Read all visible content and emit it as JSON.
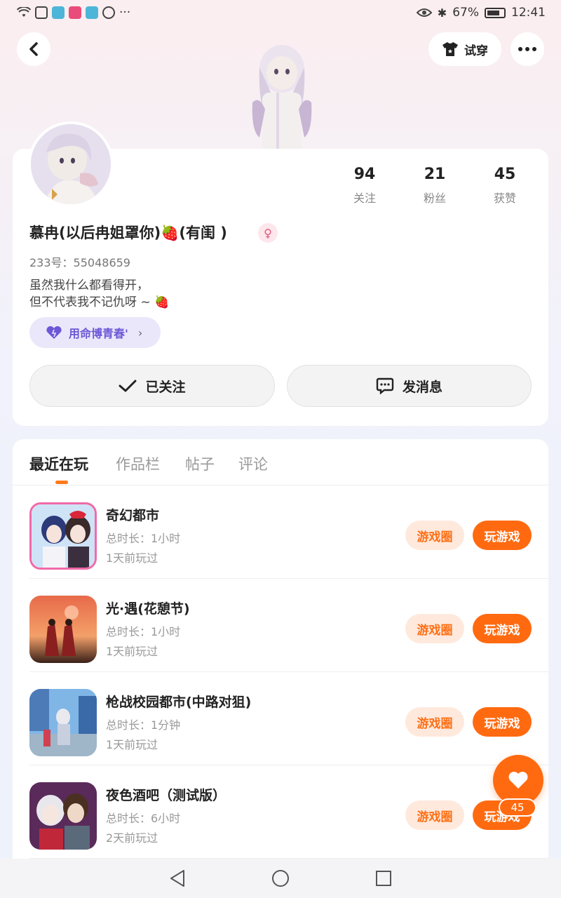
{
  "status_bar": {
    "battery": "67%",
    "time": "12:41",
    "more_indicator": "···"
  },
  "header": {
    "back_icon": "chevron-left-icon",
    "try_on_label": "试穿",
    "more_icon": "more-dots-icon"
  },
  "profile": {
    "stats": [
      {
        "value": "94",
        "label": "关注"
      },
      {
        "value": "21",
        "label": "粉丝"
      },
      {
        "value": "45",
        "label": "获赞"
      }
    ],
    "username": "慕冉(以后冉姐罩你)🍓(有闺 )",
    "gender_icon": "female-icon",
    "user_id": "233号：55048659",
    "bio_line1": "虽然我什么都看得开，",
    "bio_line2": "但不代表我不记仇呀 ~ 🍓",
    "tag_label": "用命博青春'",
    "follow_label": "已关注",
    "message_label": "发消息"
  },
  "tabs": [
    {
      "label": "最近在玩",
      "active": true
    },
    {
      "label": "作品栏",
      "active": false
    },
    {
      "label": "帖子",
      "active": false
    },
    {
      "label": "评论",
      "active": false
    }
  ],
  "games": [
    {
      "title": "奇幻都市",
      "duration": "总时长：1小时",
      "last_played": "1天前玩过",
      "circle_label": "游戏圈",
      "play_label": "玩游戏"
    },
    {
      "title": "光·遇(花憩节)",
      "duration": "总时长：1小时",
      "last_played": "1天前玩过",
      "circle_label": "游戏圈",
      "play_label": "玩游戏"
    },
    {
      "title": "枪战校园都市(中路对狙)",
      "duration": "总时长：1分钟",
      "last_played": "1天前玩过",
      "circle_label": "游戏圈",
      "play_label": "玩游戏"
    },
    {
      "title": "夜色酒吧（测试版）",
      "duration": "总时长：6小时",
      "last_played": "2天前玩过",
      "circle_label": "游戏圈",
      "play_label": "玩游戏"
    }
  ],
  "like_fab": {
    "count": "45"
  },
  "colors": {
    "accent": "#ff6a10",
    "tag": "#6c58d6"
  }
}
